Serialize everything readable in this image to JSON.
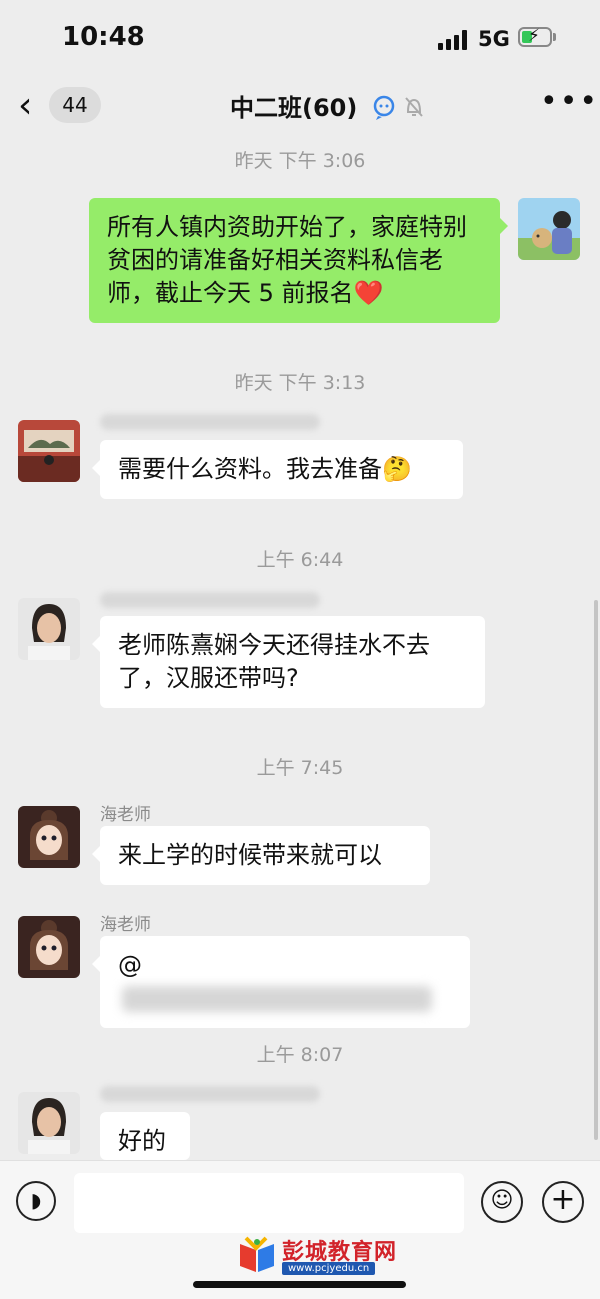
{
  "status_bar": {
    "time": "10:48",
    "network": "5G",
    "battery_level": 0.4
  },
  "header": {
    "unread_count": "44",
    "title": "中二班(60)"
  },
  "messages": [
    {
      "time": "昨天 下午 3:06",
      "text": "所有人镇内资助开始了，家庭特别贫困的请准备好相关资料私信老师，截止今天 5 前报名",
      "emoji": "❤️"
    },
    {
      "time": "昨天 下午 3:13",
      "text": "需要什么资料。我去准备",
      "emoji": "🤔"
    },
    {
      "time": "上午 6:44",
      "text": "老师陈熹娴今天还得挂水不去了，汉服还带吗?"
    },
    {
      "time": "上午 7:45",
      "sender": "海老师",
      "text": "来上学的时候带来就可以"
    },
    {
      "sender": "海老师",
      "text": "@"
    },
    {
      "time": "上午 8:07",
      "text": "好的"
    }
  ],
  "watermark": {
    "title": "彭城教育网",
    "url": "www.pcjyedu.cn"
  },
  "icons": {
    "back": "chevron-left-icon",
    "more": "more-dots-icon",
    "voice": "voice-icon",
    "emoji": "emoji-icon",
    "plus": "plus-icon",
    "mute": "bell-slash-icon"
  },
  "colors": {
    "outgoing_bubble": "#95ec69",
    "incoming_bubble": "#ffffff",
    "background": "#ededed"
  }
}
